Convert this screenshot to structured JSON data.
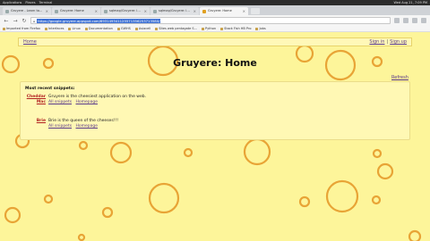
{
  "os_bar": {
    "items": [
      "Applications",
      "Places",
      "Terminal"
    ],
    "clock": "Wed Aug 21, 7:09 PM"
  },
  "tabs": [
    {
      "label": "Gruyere - Learn to...",
      "active": false
    },
    {
      "label": "Gruyere: Home",
      "active": false
    },
    {
      "label": "sqlmap/Gruyere: learnin...",
      "active": false
    },
    {
      "label": "sqlmap/Gruyere: learn...",
      "active": false
    },
    {
      "label": "Gruyere: Home",
      "active": true
    }
  ],
  "toolbar": {
    "url": "https://google-gruyere.appspot.com/693149341125571356253713580/"
  },
  "bookmarks": [
    "Imported from Firefox",
    "Interfaces",
    "Linux",
    "Documentation",
    "GWHS",
    "Asiacell",
    "Sites web pentagate S...",
    "Python",
    "Stack Fish HB Pro",
    "Jobs"
  ],
  "menu": {
    "home": "Home",
    "sign_in": "Sign in",
    "separator": "|",
    "sign_up": "Sign up"
  },
  "page": {
    "title": "Gruyere: Home",
    "refresh": "Refresh"
  },
  "panel": {
    "title": "Most recent snippets:",
    "snippets": [
      {
        "author": "Cheddar",
        "author2": "Mac",
        "body": "Gruyere is the cheesiest application on the web.",
        "link_all": "All snippets",
        "link_home": "Homepage"
      },
      {
        "author": "Brie",
        "body": "Brie is the queen of the cheeses!!!",
        "link_all": "All snippets",
        "link_home": "Homepage"
      }
    ]
  },
  "colors": {
    "page_bg": "#fdf59a",
    "circle_stroke": "#e8a436",
    "link": "#5a3a8a",
    "author": "#b22222"
  }
}
